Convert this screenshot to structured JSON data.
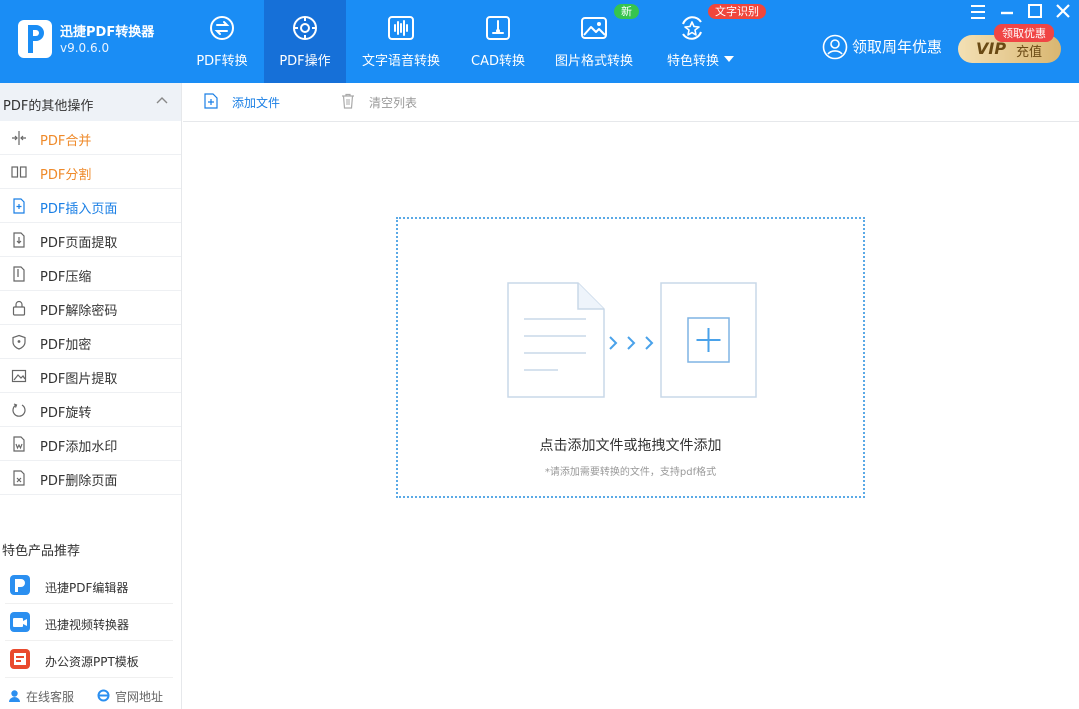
{
  "app": {
    "name": "迅捷PDF转换器",
    "version": "v9.0.6.0"
  },
  "nav": {
    "tabs": [
      {
        "label": "PDF转换",
        "icon": "pdf-convert-icon",
        "active": false
      },
      {
        "label": "PDF操作",
        "icon": "pdf-operate-icon",
        "active": true
      },
      {
        "label": "文字语音转换",
        "icon": "voice-wave-icon",
        "active": false
      },
      {
        "label": "CAD转换",
        "icon": "cad-icon",
        "active": false
      },
      {
        "label": "图片格式转换",
        "icon": "image-icon",
        "active": false,
        "badge": "新"
      },
      {
        "label": "特色转换",
        "icon": "star-convert-icon",
        "active": false,
        "badge": "文字识别"
      }
    ]
  },
  "header": {
    "user_link": "领取周年优惠",
    "vip": {
      "mark": "VIP",
      "label": "充值",
      "badge": "领取优惠"
    }
  },
  "colors": {
    "header_bg": "#1a8df5",
    "active_tab": "#1670d8",
    "accent_blue": "#1a7fe5",
    "accent_orange": "#ef8a2a"
  },
  "sidebar": {
    "title": "PDF的其他操作",
    "items": [
      {
        "label": "PDF合并",
        "icon": "merge-icon",
        "state": "orange"
      },
      {
        "label": "PDF分割",
        "icon": "split-icon",
        "state": "orange"
      },
      {
        "label": "PDF插入页面",
        "icon": "insert-page-icon",
        "state": "blue"
      },
      {
        "label": "PDF页面提取",
        "icon": "extract-page-icon",
        "state": "normal"
      },
      {
        "label": "PDF压缩",
        "icon": "compress-icon",
        "state": "normal"
      },
      {
        "label": "PDF解除密码",
        "icon": "unlock-icon",
        "state": "normal"
      },
      {
        "label": "PDF加密",
        "icon": "shield-icon",
        "state": "normal"
      },
      {
        "label": "PDF图片提取",
        "icon": "picture-icon",
        "state": "normal"
      },
      {
        "label": "PDF旋转",
        "icon": "rotate-icon",
        "state": "normal"
      },
      {
        "label": "PDF添加水印",
        "icon": "watermark-icon",
        "state": "normal"
      },
      {
        "label": "PDF删除页面",
        "icon": "delete-page-icon",
        "state": "normal"
      }
    ],
    "featured_title": "特色产品推荐",
    "products": [
      {
        "label": "迅捷PDF编辑器",
        "icon": "pdf-editor-icon"
      },
      {
        "label": "迅捷视频转换器",
        "icon": "video-converter-icon"
      },
      {
        "label": "办公资源PPT模板",
        "icon": "ppt-template-icon"
      }
    ],
    "footer": {
      "service": "在线客服",
      "website": "官网地址"
    }
  },
  "toolbar": {
    "add_file": "添加文件",
    "clear_list": "清空列表"
  },
  "drop_zone": {
    "text": "点击添加文件或拖拽文件添加",
    "hint": "*请添加需要转换的文件，支持pdf格式"
  }
}
